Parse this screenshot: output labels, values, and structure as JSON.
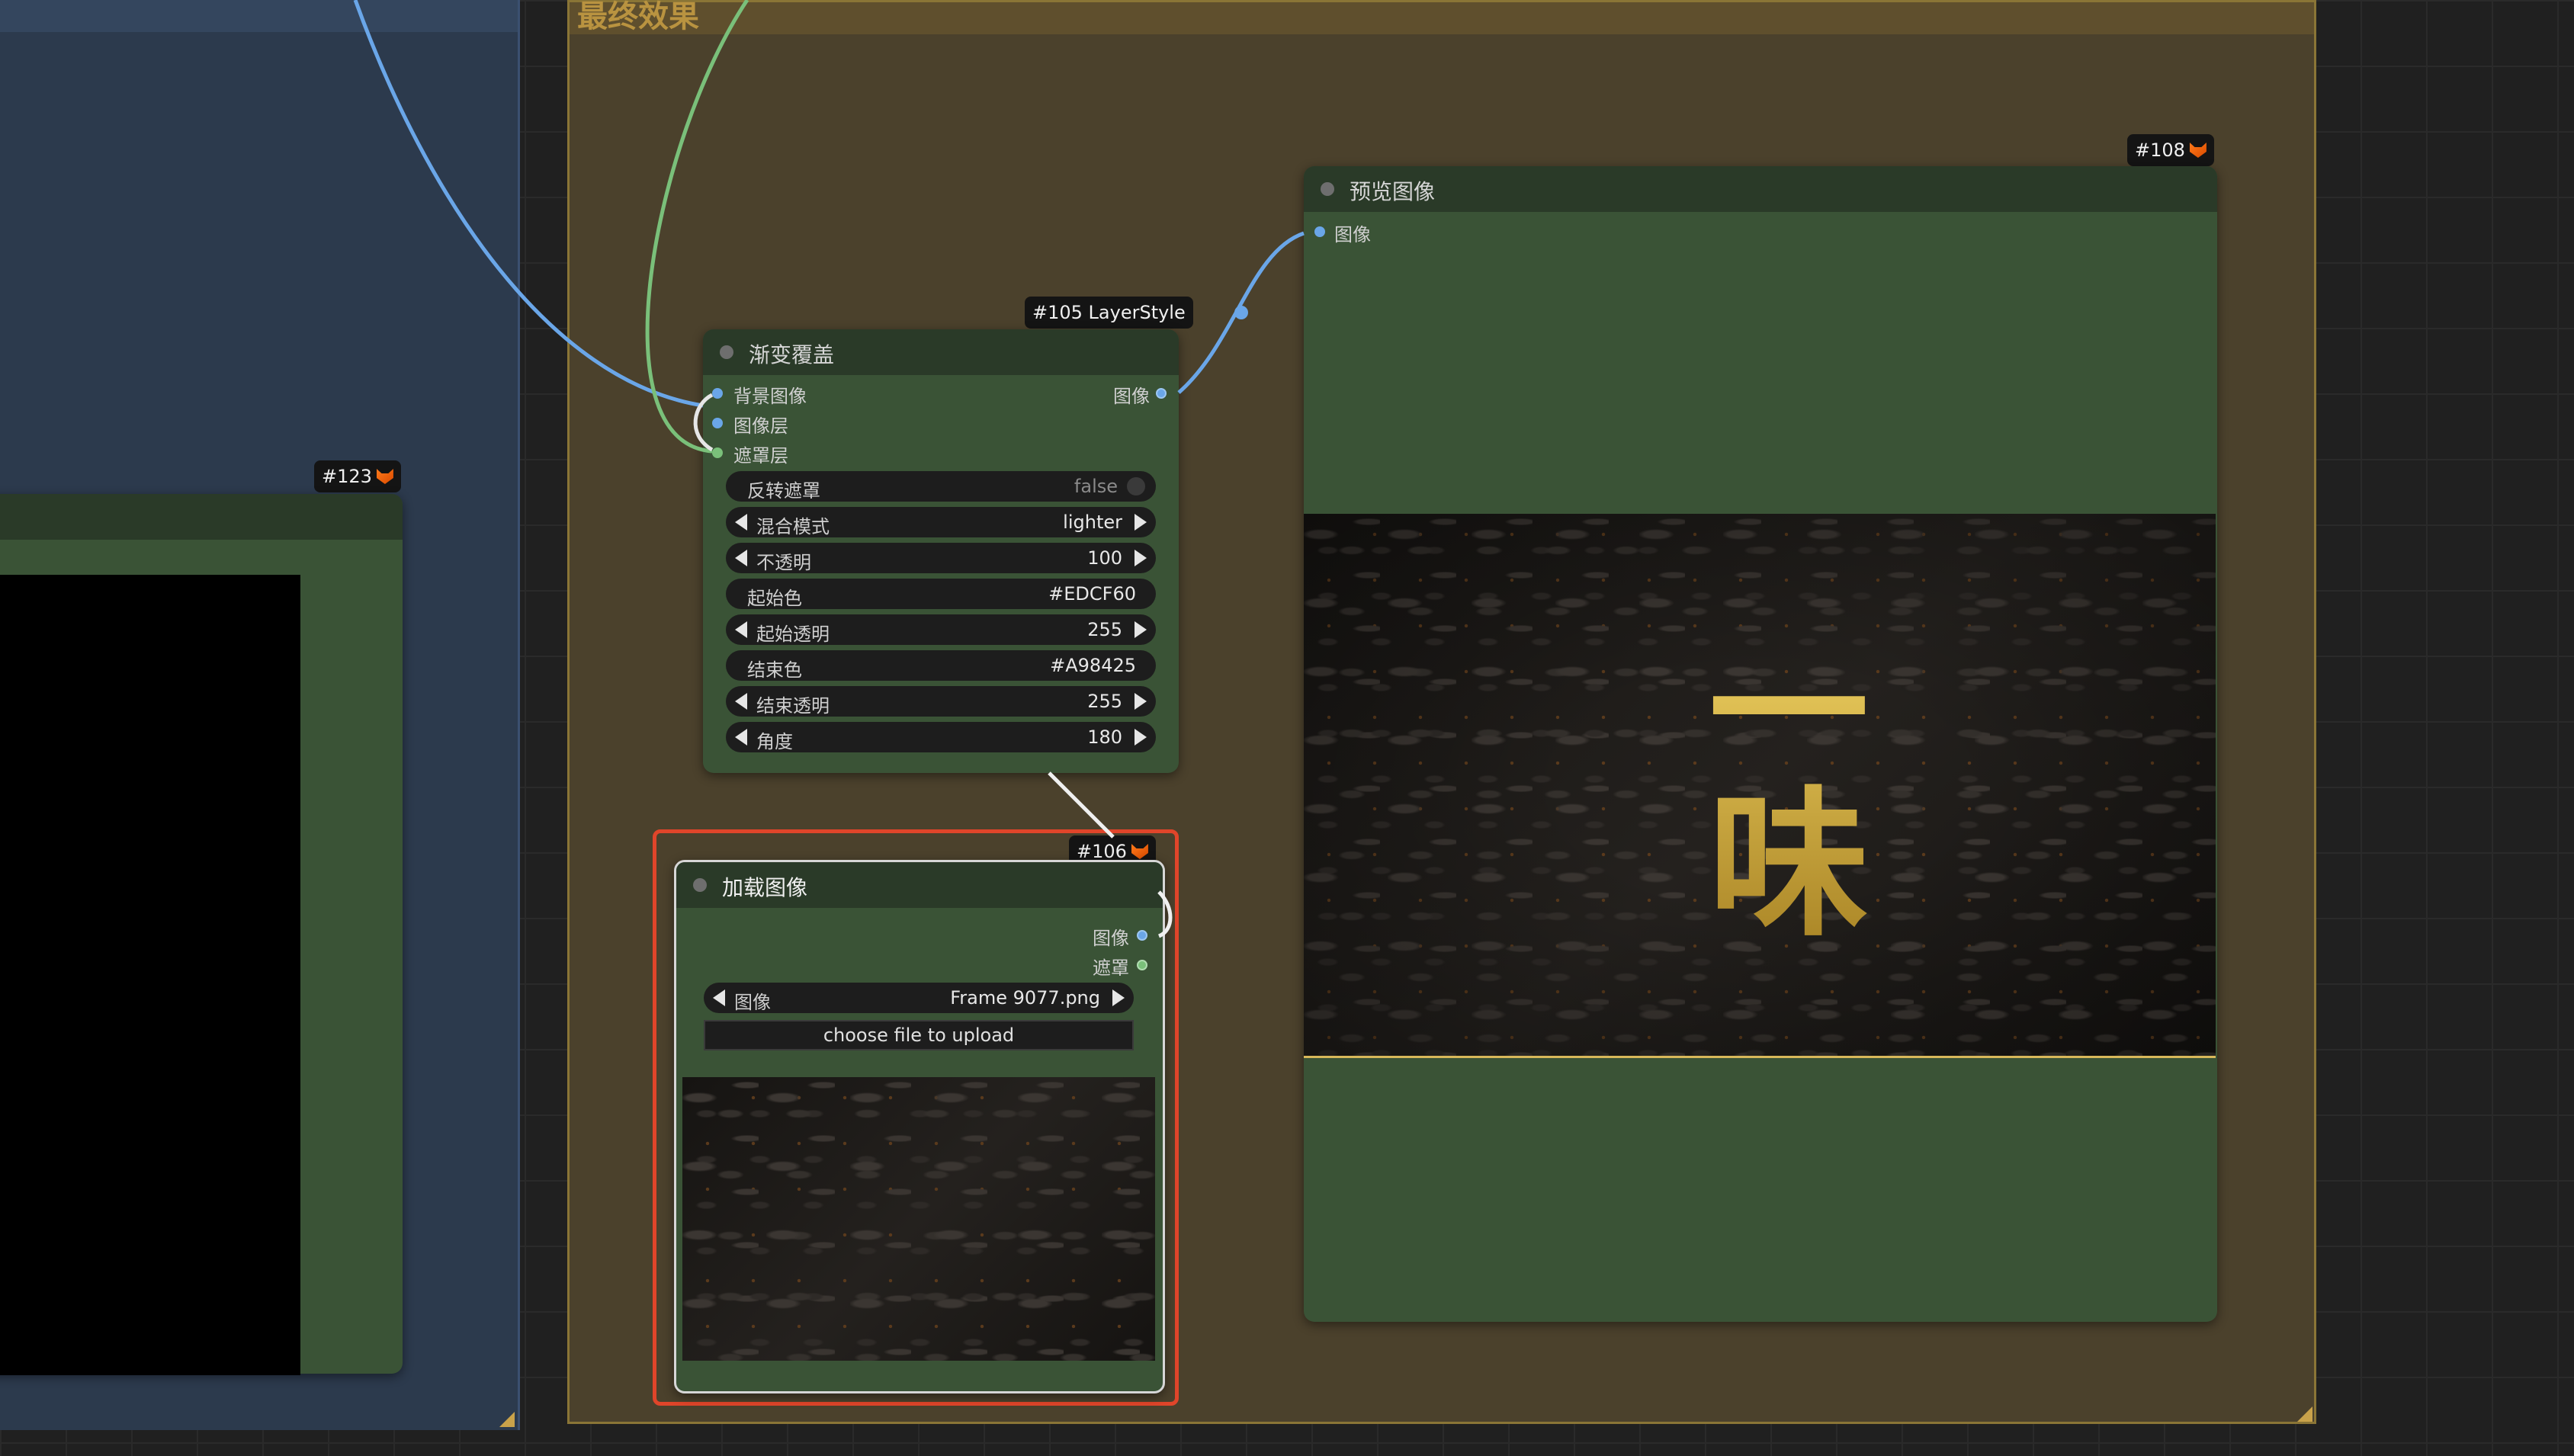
{
  "groups": {
    "main_title": "最终效果"
  },
  "nodes": {
    "n123": {
      "badge": "#123"
    },
    "n105": {
      "badge": "#105 LayerStyle",
      "title": "渐变覆盖",
      "inputs": [
        "背景图像",
        "图像层",
        "遮罩层"
      ],
      "output": "图像",
      "widgets": {
        "invert_mask": {
          "label": "反转遮罩",
          "value": "false"
        },
        "blend_mode": {
          "label": "混合模式",
          "value": "lighter"
        },
        "opacity": {
          "label": "不透明",
          "value": "100"
        },
        "start_color": {
          "label": "起始色",
          "value": "#EDCF60"
        },
        "start_alpha": {
          "label": "起始透明",
          "value": "255"
        },
        "end_color": {
          "label": "结束色",
          "value": "#A98425"
        },
        "end_alpha": {
          "label": "结束透明",
          "value": "255"
        },
        "angle": {
          "label": "角度",
          "value": "180"
        }
      }
    },
    "n106": {
      "badge": "#106",
      "title": "加载图像",
      "outputs": [
        "图像",
        "遮罩"
      ],
      "image_widget": {
        "label": "图像",
        "value": "Frame 9077.png"
      },
      "upload_label": "choose file to upload"
    },
    "n108": {
      "badge": "#108",
      "title": "预览图像",
      "input": "图像",
      "calligraphy": "一味"
    }
  },
  "colors": {
    "link_image": "#6aa6e8",
    "link_mask": "#7ac07a",
    "selection": "#e0452a",
    "gradient_start": "#EDCF60",
    "gradient_end": "#A98425"
  }
}
